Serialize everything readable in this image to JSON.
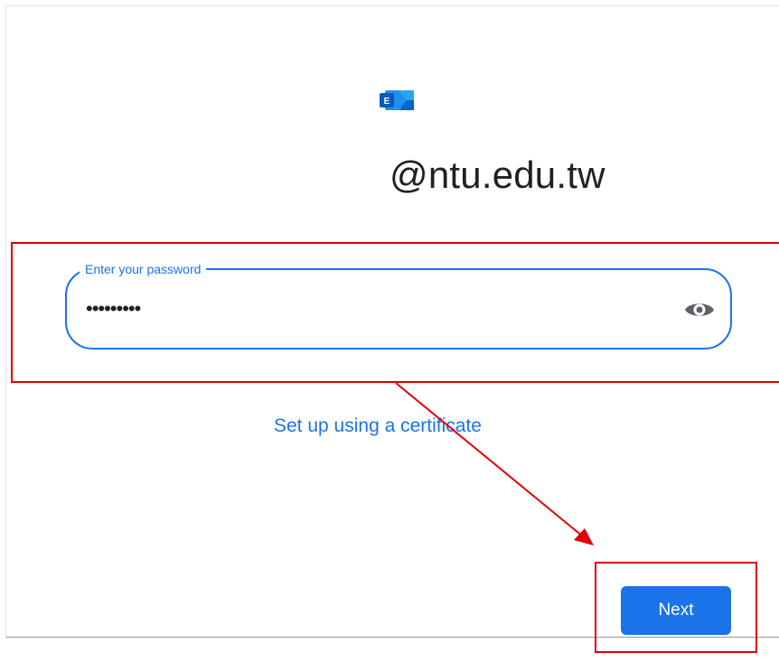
{
  "account": {
    "domain": "@ntu.edu.tw",
    "app_icon": "exchange-logo-icon"
  },
  "password": {
    "label": "Enter your password",
    "masked_value": "•••••••••",
    "toggle_icon": "eye-icon"
  },
  "links": {
    "certificate": "Set up using a certificate"
  },
  "actions": {
    "next_label": "Next"
  },
  "colors": {
    "accent": "#1a73e8",
    "annotation": "#e00000",
    "text": "#202124"
  }
}
